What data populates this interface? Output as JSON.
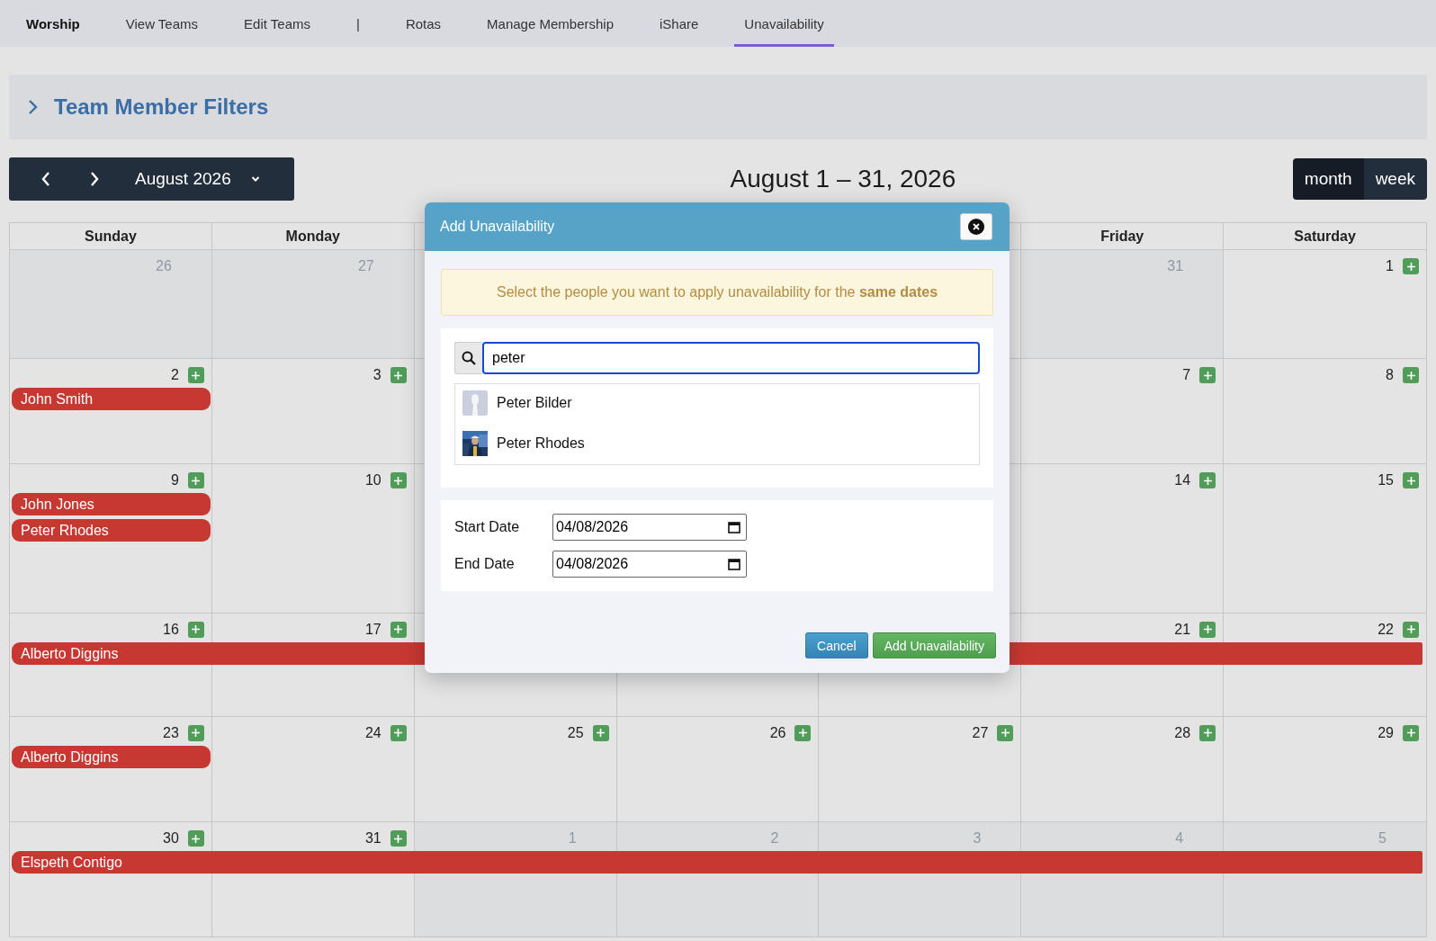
{
  "nav": [
    {
      "label": "Worship",
      "kind": "brand",
      "selected": false
    },
    {
      "label": "View Teams",
      "kind": "link",
      "selected": false
    },
    {
      "label": "Edit Teams",
      "kind": "link",
      "selected": false
    },
    {
      "label": "|",
      "kind": "separator",
      "selected": false
    },
    {
      "label": "Rotas",
      "kind": "link",
      "selected": false
    },
    {
      "label": "Manage Membership",
      "kind": "link",
      "selected": false
    },
    {
      "label": "iShare",
      "kind": "link",
      "selected": false
    },
    {
      "label": "Unavailability",
      "kind": "link",
      "selected": true
    }
  ],
  "filters": {
    "title": "Team Member Filters",
    "expanded": false
  },
  "toolbar": {
    "month_picker": "August 2026",
    "title": "August 1 – 31, 2026",
    "views": [
      {
        "label": "month",
        "selected": true
      },
      {
        "label": "week",
        "selected": false
      }
    ]
  },
  "calendar": {
    "weekdays_left": [
      "Sunday",
      "Monday"
    ],
    "weekdays_right": [
      "Friday",
      "Saturday"
    ],
    "weeks": [
      {
        "days": [
          {
            "number": "26",
            "other_month": true
          },
          {
            "number": "27",
            "other_month": true
          }
        ],
        "days_right": [
          {
            "number": "31",
            "other_month": true
          },
          {
            "number": "1",
            "other_month": false
          }
        ]
      },
      {
        "days": [
          {
            "number": "2",
            "other_month": false,
            "events": [
              {
                "name": "John Smith",
                "kind": "single"
              }
            ]
          },
          {
            "number": "3",
            "other_month": false
          }
        ],
        "days_right": [
          {
            "number": "7",
            "other_month": false
          },
          {
            "number": "8",
            "other_month": false
          }
        ]
      },
      {
        "days": [
          {
            "number": "9",
            "other_month": false,
            "events": [
              {
                "name": "John Jones",
                "kind": "single"
              },
              {
                "name": "Peter Rhodes",
                "kind": "single"
              }
            ]
          },
          {
            "number": "10",
            "other_month": false
          }
        ],
        "days_right": [
          {
            "number": "14",
            "other_month": false
          },
          {
            "number": "15",
            "other_month": false
          }
        ]
      },
      {
        "days": [
          {
            "number": "16",
            "other_month": false,
            "events": [
              {
                "name": "Alberto Diggins",
                "kind": "week-span"
              }
            ]
          },
          {
            "number": "17",
            "other_month": false
          }
        ],
        "days_right": [
          {
            "number": "21",
            "other_month": false
          },
          {
            "number": "22",
            "other_month": false
          }
        ]
      },
      {
        "days": [
          {
            "number": "23",
            "other_month": false,
            "events": [
              {
                "name": "Alberto Diggins",
                "kind": "single"
              }
            ]
          },
          {
            "number": "24",
            "other_month": false
          },
          {
            "number": "25",
            "other_month": false
          },
          {
            "number": "26",
            "other_month": false
          },
          {
            "number": "27",
            "other_month": false
          },
          {
            "number": "28",
            "other_month": false
          },
          {
            "number": "29",
            "other_month": false
          }
        ]
      },
      {
        "days": [
          {
            "number": "30",
            "other_month": false,
            "events": [
              {
                "name": "Elspeth Contigo",
                "kind": "week-span"
              }
            ]
          },
          {
            "number": "31",
            "other_month": false
          },
          {
            "number": "1",
            "other_month": true
          },
          {
            "number": "2",
            "other_month": true
          },
          {
            "number": "3",
            "other_month": true
          },
          {
            "number": "4",
            "other_month": true
          },
          {
            "number": "5",
            "other_month": true
          }
        ]
      }
    ]
  },
  "modal": {
    "title": "Add Unavailability",
    "notice": "Select the people you want to apply unavailability for the **same dates**",
    "search": {
      "value": "peter"
    },
    "results": [
      {
        "name": "Peter Bilder",
        "kind": "silhouette"
      },
      {
        "name": "Peter Rhodes",
        "kind": "picture"
      }
    ],
    "dates": [
      {
        "label": "Start Date",
        "value": "04/08/2026"
      },
      {
        "label": "End Date",
        "value": "04/08/2026"
      }
    ],
    "buttons": [
      {
        "label": "Cancel",
        "kind": "secondary"
      },
      {
        "label": "Add Unavailability",
        "kind": "primary"
      }
    ]
  }
}
